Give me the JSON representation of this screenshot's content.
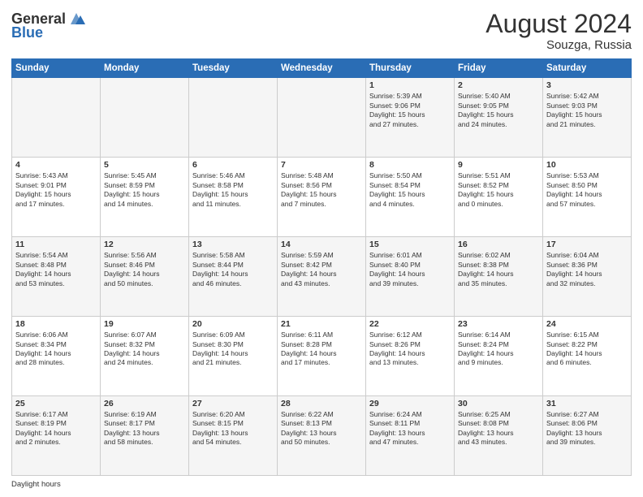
{
  "header": {
    "logo_general": "General",
    "logo_blue": "Blue",
    "month_year": "August 2024",
    "location": "Souzga, Russia"
  },
  "days_of_week": [
    "Sunday",
    "Monday",
    "Tuesday",
    "Wednesday",
    "Thursday",
    "Friday",
    "Saturday"
  ],
  "weeks": [
    [
      {
        "day": "",
        "info": ""
      },
      {
        "day": "",
        "info": ""
      },
      {
        "day": "",
        "info": ""
      },
      {
        "day": "",
        "info": ""
      },
      {
        "day": "1",
        "info": "Sunrise: 5:39 AM\nSunset: 9:06 PM\nDaylight: 15 hours\nand 27 minutes."
      },
      {
        "day": "2",
        "info": "Sunrise: 5:40 AM\nSunset: 9:05 PM\nDaylight: 15 hours\nand 24 minutes."
      },
      {
        "day": "3",
        "info": "Sunrise: 5:42 AM\nSunset: 9:03 PM\nDaylight: 15 hours\nand 21 minutes."
      }
    ],
    [
      {
        "day": "4",
        "info": "Sunrise: 5:43 AM\nSunset: 9:01 PM\nDaylight: 15 hours\nand 17 minutes."
      },
      {
        "day": "5",
        "info": "Sunrise: 5:45 AM\nSunset: 8:59 PM\nDaylight: 15 hours\nand 14 minutes."
      },
      {
        "day": "6",
        "info": "Sunrise: 5:46 AM\nSunset: 8:58 PM\nDaylight: 15 hours\nand 11 minutes."
      },
      {
        "day": "7",
        "info": "Sunrise: 5:48 AM\nSunset: 8:56 PM\nDaylight: 15 hours\nand 7 minutes."
      },
      {
        "day": "8",
        "info": "Sunrise: 5:50 AM\nSunset: 8:54 PM\nDaylight: 15 hours\nand 4 minutes."
      },
      {
        "day": "9",
        "info": "Sunrise: 5:51 AM\nSunset: 8:52 PM\nDaylight: 15 hours\nand 0 minutes."
      },
      {
        "day": "10",
        "info": "Sunrise: 5:53 AM\nSunset: 8:50 PM\nDaylight: 14 hours\nand 57 minutes."
      }
    ],
    [
      {
        "day": "11",
        "info": "Sunrise: 5:54 AM\nSunset: 8:48 PM\nDaylight: 14 hours\nand 53 minutes."
      },
      {
        "day": "12",
        "info": "Sunrise: 5:56 AM\nSunset: 8:46 PM\nDaylight: 14 hours\nand 50 minutes."
      },
      {
        "day": "13",
        "info": "Sunrise: 5:58 AM\nSunset: 8:44 PM\nDaylight: 14 hours\nand 46 minutes."
      },
      {
        "day": "14",
        "info": "Sunrise: 5:59 AM\nSunset: 8:42 PM\nDaylight: 14 hours\nand 43 minutes."
      },
      {
        "day": "15",
        "info": "Sunrise: 6:01 AM\nSunset: 8:40 PM\nDaylight: 14 hours\nand 39 minutes."
      },
      {
        "day": "16",
        "info": "Sunrise: 6:02 AM\nSunset: 8:38 PM\nDaylight: 14 hours\nand 35 minutes."
      },
      {
        "day": "17",
        "info": "Sunrise: 6:04 AM\nSunset: 8:36 PM\nDaylight: 14 hours\nand 32 minutes."
      }
    ],
    [
      {
        "day": "18",
        "info": "Sunrise: 6:06 AM\nSunset: 8:34 PM\nDaylight: 14 hours\nand 28 minutes."
      },
      {
        "day": "19",
        "info": "Sunrise: 6:07 AM\nSunset: 8:32 PM\nDaylight: 14 hours\nand 24 minutes."
      },
      {
        "day": "20",
        "info": "Sunrise: 6:09 AM\nSunset: 8:30 PM\nDaylight: 14 hours\nand 21 minutes."
      },
      {
        "day": "21",
        "info": "Sunrise: 6:11 AM\nSunset: 8:28 PM\nDaylight: 14 hours\nand 17 minutes."
      },
      {
        "day": "22",
        "info": "Sunrise: 6:12 AM\nSunset: 8:26 PM\nDaylight: 14 hours\nand 13 minutes."
      },
      {
        "day": "23",
        "info": "Sunrise: 6:14 AM\nSunset: 8:24 PM\nDaylight: 14 hours\nand 9 minutes."
      },
      {
        "day": "24",
        "info": "Sunrise: 6:15 AM\nSunset: 8:22 PM\nDaylight: 14 hours\nand 6 minutes."
      }
    ],
    [
      {
        "day": "25",
        "info": "Sunrise: 6:17 AM\nSunset: 8:19 PM\nDaylight: 14 hours\nand 2 minutes."
      },
      {
        "day": "26",
        "info": "Sunrise: 6:19 AM\nSunset: 8:17 PM\nDaylight: 13 hours\nand 58 minutes."
      },
      {
        "day": "27",
        "info": "Sunrise: 6:20 AM\nSunset: 8:15 PM\nDaylight: 13 hours\nand 54 minutes."
      },
      {
        "day": "28",
        "info": "Sunrise: 6:22 AM\nSunset: 8:13 PM\nDaylight: 13 hours\nand 50 minutes."
      },
      {
        "day": "29",
        "info": "Sunrise: 6:24 AM\nSunset: 8:11 PM\nDaylight: 13 hours\nand 47 minutes."
      },
      {
        "day": "30",
        "info": "Sunrise: 6:25 AM\nSunset: 8:08 PM\nDaylight: 13 hours\nand 43 minutes."
      },
      {
        "day": "31",
        "info": "Sunrise: 6:27 AM\nSunset: 8:06 PM\nDaylight: 13 hours\nand 39 minutes."
      }
    ]
  ],
  "footer": {
    "daylight_label": "Daylight hours"
  }
}
